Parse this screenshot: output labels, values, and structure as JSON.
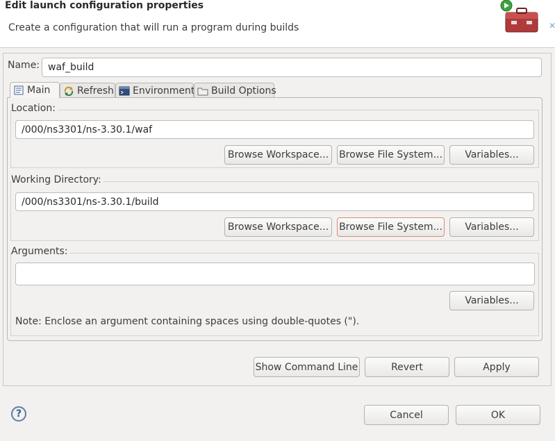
{
  "header": {
    "title": "Edit launch configuration properties",
    "subtitle": "Create a configuration that will run a program during builds",
    "close_glyph": "✕"
  },
  "name_row": {
    "label": "Name:",
    "value": "waf_build"
  },
  "tabs": [
    {
      "label": "Main",
      "icon": "main-tab-icon",
      "active": true
    },
    {
      "label": "Refresh",
      "icon": "refresh-icon",
      "active": false
    },
    {
      "label": "Environment",
      "icon": "environment-icon",
      "active": false
    },
    {
      "label": "Build Options",
      "icon": "build-options-icon",
      "active": false
    }
  ],
  "location": {
    "label": "Location:",
    "value": "/000/ns3301/ns-3.30.1/waf",
    "browse_workspace": "Browse Workspace...",
    "browse_file_system": "Browse File System...",
    "variables": "Variables..."
  },
  "working_directory": {
    "label": "Working Directory:",
    "value": "/000/ns3301/ns-3.30.1/build",
    "browse_workspace": "Browse Workspace...",
    "browse_file_system": "Browse File System...",
    "variables": "Variables..."
  },
  "arguments": {
    "label": "Arguments:",
    "value": "",
    "variables": "Variables...",
    "note": "Note: Enclose an argument containing spaces using double-quotes (\")."
  },
  "actions": {
    "show_command_line": "Show Command Line",
    "revert": "Revert",
    "apply": "Apply"
  },
  "footer": {
    "help": "?",
    "cancel": "Cancel",
    "ok": "OK"
  },
  "colors": {
    "accent_focus": "#e08a70",
    "banner_toolbox": "#b03a3a",
    "banner_run_badge": "#3ea23e"
  }
}
